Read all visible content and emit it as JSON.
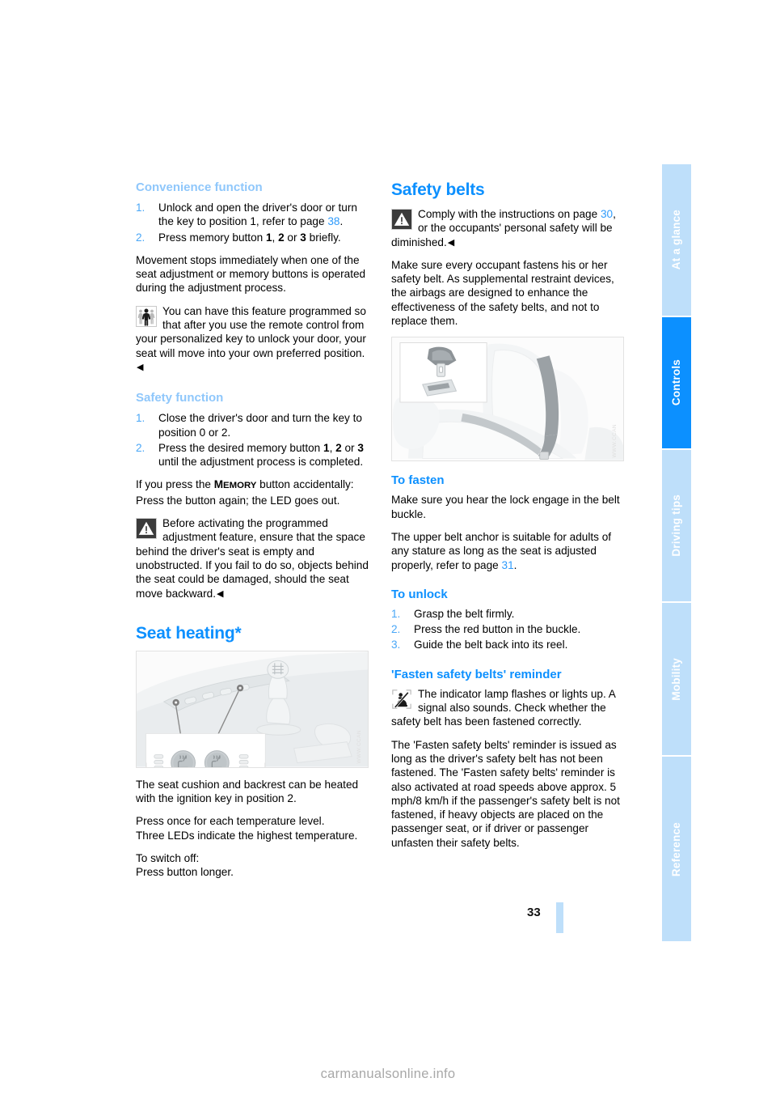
{
  "page": {
    "number": "33",
    "watermark": "carmanualsonline.info"
  },
  "tabs": [
    {
      "label": "At a glance",
      "active": false
    },
    {
      "label": "Controls",
      "active": true
    },
    {
      "label": "Driving tips",
      "active": false
    },
    {
      "label": "Mobility",
      "active": false
    },
    {
      "label": "Reference",
      "active": false
    }
  ],
  "colors": {
    "heading_blue": "#0c90ff",
    "subheading_blue": "#8fc7fb",
    "tab_inactive": "#bedffa",
    "tab_active": "#0c90ff",
    "page_ref": "#2e9bfc"
  },
  "left_column": {
    "convenience": {
      "heading": "Convenience function",
      "steps": [
        {
          "num": "1.",
          "text_a": "Unlock and open the driver's door or turn the key to position 1, refer to page ",
          "ref": "38",
          "text_b": "."
        },
        {
          "num": "2.",
          "text_pre": "Press memory button ",
          "b1": "1",
          "sep1": ", ",
          "b2": "2",
          "sep2": " or ",
          "b3": "3",
          "text_post": " briefly."
        }
      ],
      "para1": "Movement stops immediately when one of the seat adjustment or memory buttons is operated during the adjustment process.",
      "note": {
        "icon": "person-remote-icon",
        "text": "You can have this feature programmed so that after you use the remote control from your personalized key to unlock your door, your seat will move into your own preferred position.",
        "endmark": "◀"
      }
    },
    "safety_function": {
      "heading": "Safety function",
      "steps": [
        {
          "num": "1.",
          "text": "Close the driver's door and turn the key to position 0 or 2."
        },
        {
          "num": "2.",
          "text_pre": "Press the desired memory button ",
          "b1": "1",
          "sep1": ", ",
          "b2": "2",
          "sep2": " or ",
          "b3": "3",
          "text_post": " until the adjustment process is completed."
        }
      ],
      "memory_line_pre": "If you press the ",
      "memory_cap": "M",
      "memory_rest": "EMORY",
      "memory_line_post": " button accidentally:",
      "memory_line2": "Press the button again; the LED goes out.",
      "warning": {
        "icon": "warning-triangle-icon",
        "text": "Before activating the programmed adjustment feature, ensure that the space behind the driver's seat is empty and unobstructed. If you fail to do so, objects behind the seat could be damaged, should the seat move backward.",
        "endmark": "◀"
      }
    },
    "seat_heating": {
      "heading": "Seat heating*",
      "figure_alt": "Center console with gear shift lever and two seat heating buttons with LED indicators",
      "figure_code": "WWW.CCAN",
      "para1": "The seat cushion and backrest can be heated with the ignition key in position 2.",
      "para2_line1": "Press once for each temperature level.",
      "para2_line2": "Three LEDs indicate the highest temperature.",
      "para3_line1": "To switch off:",
      "para3_line2": "Press button longer."
    }
  },
  "right_column": {
    "safety_belts": {
      "heading": "Safety belts",
      "warning": {
        "icon": "warning-triangle-icon",
        "text_a": "Comply with the instructions on page ",
        "ref": "30",
        "text_b": ", or the occupants' personal safety will be diminished.",
        "endmark": "◀"
      },
      "para1": "Make sure every occupant fastens his or her safety belt. As supplemental restraint devices, the airbags are designed to enhance the effectiveness of the safety belts, and not to replace them.",
      "figure_alt": "Vehicle seat with fastened diagonal safety belt and inset detail of belt tongue and buckle",
      "figure_code": "WWW.CCAN"
    },
    "to_fasten": {
      "heading": "To fasten",
      "para1": "Make sure you hear the lock engage in the belt buckle.",
      "para2_a": "The upper belt anchor is suitable for adults of any stature as long as the seat is adjusted properly, refer to page ",
      "para2_ref": "31",
      "para2_b": "."
    },
    "to_unlock": {
      "heading": "To unlock",
      "steps": [
        {
          "num": "1.",
          "text": "Grasp the belt firmly."
        },
        {
          "num": "2.",
          "text": "Press the red button in the buckle."
        },
        {
          "num": "3.",
          "text": "Guide the belt back into its reel."
        }
      ]
    },
    "reminder": {
      "heading": "'Fasten safety belts' reminder",
      "note": {
        "icon": "seatbelt-reminder-lamp-icon",
        "text": "The indicator lamp flashes or lights up. A signal also sounds. Check whether the safety belt has been fastened correctly."
      },
      "para1": "The 'Fasten safety belts' reminder is issued as long as the driver's safety belt has not been fastened. The 'Fasten safety belts' reminder is also activated at road speeds above approx. 5 mph/8 km/h if the passenger's safety belt is not fastened, if heavy objects are placed on the passenger seat, or if driver or passenger unfasten their safety belts."
    }
  }
}
